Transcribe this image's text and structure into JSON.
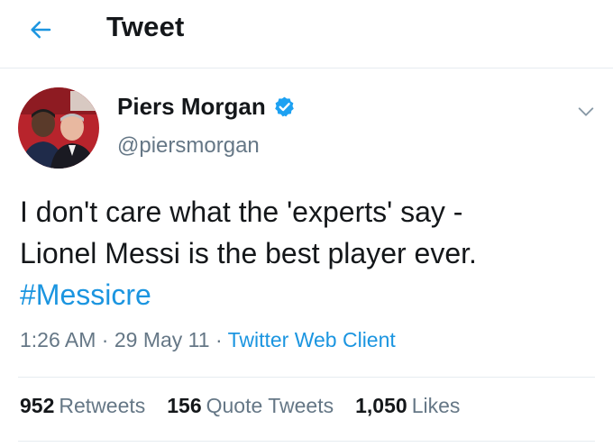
{
  "header": {
    "title": "Tweet",
    "back_icon": "arrow-left-icon"
  },
  "tweet": {
    "author": {
      "display_name": "Piers Morgan",
      "handle": "@piersmorgan",
      "verified": true
    },
    "text_line_1": "I don't care what the 'experts' say -",
    "text_line_2": "Lionel Messi is the best player ever.",
    "hashtag": "#Messicre",
    "time": "1:26 AM",
    "separator": "·",
    "date": "29 May 11",
    "source": "Twitter Web Client",
    "stats": {
      "retweets_count": "952",
      "retweets_label": "Retweets",
      "quotes_count": "156",
      "quotes_label": "Quote Tweets",
      "likes_count": "1,050",
      "likes_label": "Likes"
    }
  },
  "colors": {
    "accent": "#1b95e0",
    "secondary_text": "#657786",
    "primary_text": "#14171a",
    "divider": "#e6ecf0"
  }
}
